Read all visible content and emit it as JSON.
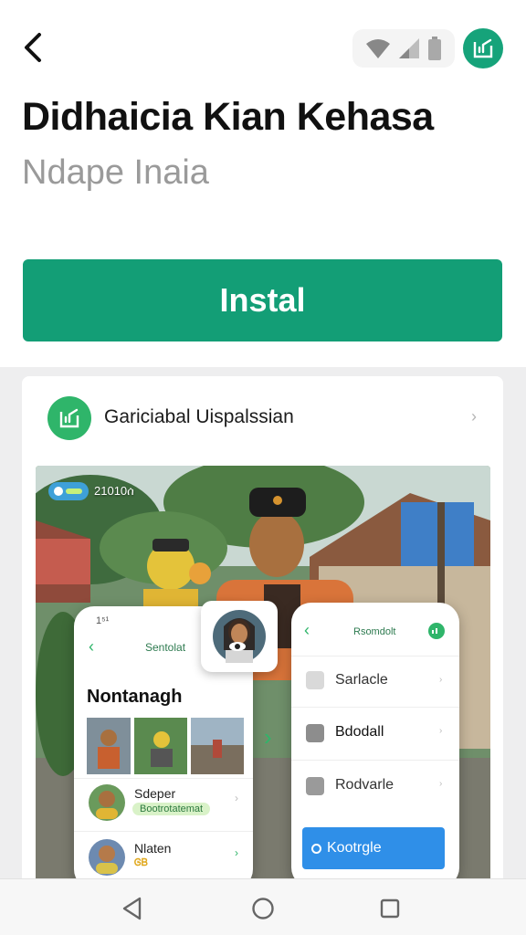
{
  "header": {
    "app_title": "Didhaicia Kian Kehasa",
    "app_subtitle": "Ndape Inaia"
  },
  "install": {
    "label": "Instal"
  },
  "card": {
    "title": "Gariciabal Uispalssian",
    "hero": {
      "badge_text": "21010ሰ",
      "left_phone": {
        "time": "1⁵¹",
        "nav_title": "Sentolat",
        "heading": "Nontanagh",
        "items": [
          {
            "name": "Sdeper",
            "tag": "Bootrotatemat"
          },
          {
            "name": "Nlaten",
            "tag": "ᎶᏴ"
          }
        ]
      },
      "right_phone": {
        "nav_title": "Rsomdolt",
        "options": [
          "Sarlacle",
          "Bdodall",
          "Rodvarle"
        ],
        "action_label": "Kootrgle"
      }
    }
  },
  "colors": {
    "accent": "#139e76",
    "primary_blue": "#2f8fe8"
  }
}
